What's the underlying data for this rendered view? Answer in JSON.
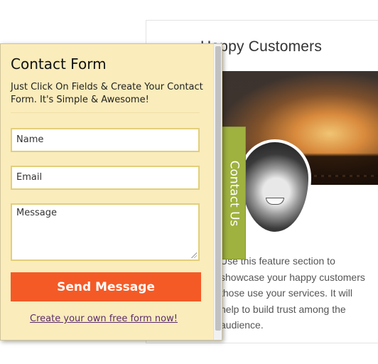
{
  "background": {
    "title": "Happy Customers",
    "text": "Use this feature section to showcase your happy customers those use your services. It will help to build trust among the audience."
  },
  "tab": {
    "label": "Contact Us"
  },
  "form": {
    "title": "Contact Form",
    "description": "Just Click On Fields & Create Your Contact Form. It's Simple & Awesome!",
    "name_placeholder": "Name",
    "email_placeholder": "Email",
    "message_placeholder": "Message",
    "submit_label": "Send Message",
    "footer_link": "Create your own free form now!"
  },
  "colors": {
    "panel_bg": "#faecbb",
    "field_border": "#e2cf7a",
    "submit_bg": "#f45a26",
    "tab_bg": "#9fb13f",
    "link_color": "#5a2b6c"
  }
}
